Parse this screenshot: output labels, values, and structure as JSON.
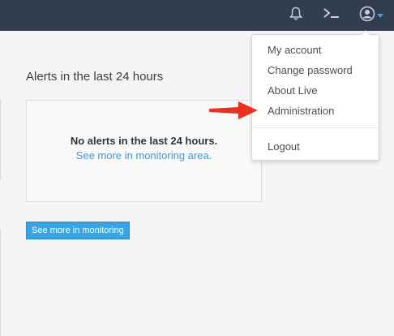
{
  "colors": {
    "topbar_bg": "#323d4f",
    "topbar_icon": "#c9ced6",
    "link": "#3a9ad9",
    "button_bg": "#3aa3e3",
    "annotation_arrow": "#e8321f"
  },
  "topbar": {
    "icons": [
      "bell-icon",
      "terminal-icon",
      "user-icon",
      "caret-down-icon"
    ]
  },
  "main": {
    "section_title": "Alerts in the last 24 hours",
    "alert_box": {
      "headline": "No alerts in the last 24 hours.",
      "link": "See more in monitoring area."
    },
    "monitor_button": "See more in monitoring"
  },
  "user_menu": {
    "items": [
      {
        "label": "My account"
      },
      {
        "label": "Change password"
      },
      {
        "label": "About Live"
      },
      {
        "label": "Administration"
      },
      {
        "label": "Logout"
      }
    ]
  }
}
